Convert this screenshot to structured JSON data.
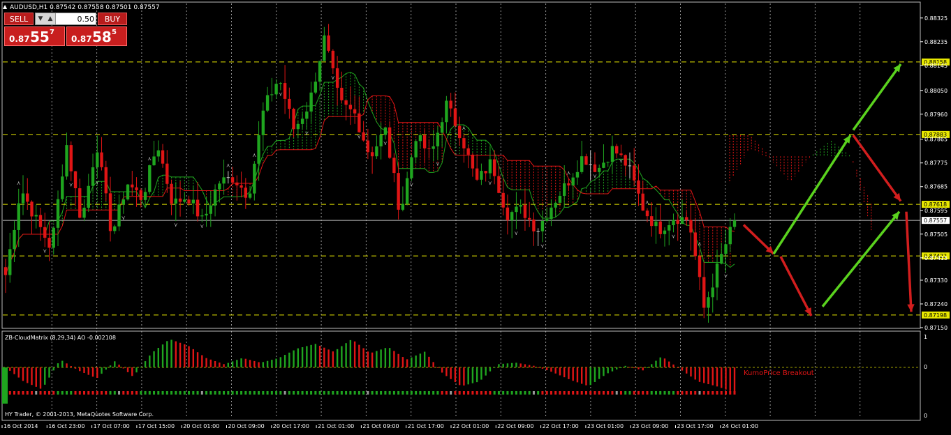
{
  "header": {
    "title": "AUDUSD,H1  0.87542 0.87558 0.87501 0.87557",
    "arrow_glyph": "▲"
  },
  "trade_panel": {
    "sell_label": "SELL",
    "buy_label": "BUY",
    "lot_value": "0.50",
    "sell_prefix": "0.87",
    "sell_big": "55",
    "sell_sup": "7",
    "buy_prefix": "0.87",
    "buy_big": "58",
    "buy_sup": "5"
  },
  "indicator": {
    "title": "ZB-CloudMatrix (8,29,34)  AO -0.002108",
    "annotation": "KumoPrice Breakout",
    "scale_labels": [
      "1",
      "0",
      "0"
    ]
  },
  "footer": {
    "copyright": "HY Trader, © 2001-2013, MetaQuotes Software Corp."
  },
  "colors": {
    "background": "#000000",
    "bull": "#1fa51f",
    "bear": "#e01515",
    "doji": "#c8c8c8",
    "level_line": "#e8e800",
    "arrow_up": "#5ad21e",
    "arrow_down": "#d21e1e",
    "grid": "#c8c8c8",
    "ao_neutral": "#9a9a9a"
  },
  "chart_data": {
    "type": "candlestick",
    "symbol": "AUDUSD",
    "timeframe": "H1",
    "ylim": [
      0.8715,
      0.8838
    ],
    "y_ticks": [
      "0.88325",
      "0.88235",
      "0.88145",
      "0.88050",
      "0.87960",
      "0.87865",
      "0.87775",
      "0.87685",
      "0.87595",
      "0.87505",
      "0.87415",
      "0.87330",
      "0.87240",
      "0.87150"
    ],
    "x_labels": [
      "16 Oct 2014",
      "16 Oct 23:00",
      "17 Oct 07:00",
      "17 Oct 15:00",
      "20 Oct 01:00",
      "20 Oct 09:00",
      "20 Oct 17:00",
      "21 Oct 01:00",
      "21 Oct 09:00",
      "21 Oct 17:00",
      "22 Oct 01:00",
      "22 Oct 09:00",
      "22 Oct 17:00",
      "23 Oct 01:00",
      "23 Oct 09:00",
      "23 Oct 17:00",
      "24 Oct 01:00"
    ],
    "levels": [
      {
        "label": "0.88158",
        "value": 0.88158
      },
      {
        "label": "0.87883",
        "value": 0.87883
      },
      {
        "label": "0.87618",
        "value": 0.87618
      },
      {
        "label": "0.87422",
        "value": 0.87422
      },
      {
        "label": "0.87198",
        "value": 0.87198
      }
    ],
    "current_price": {
      "label": "0.87557",
      "value": 0.87557
    },
    "key_prices": [
      0.8735,
      0.8768,
      0.8756,
      0.8745,
      0.8785,
      0.8755,
      0.8785,
      0.875,
      0.877,
      0.8764,
      0.8785,
      0.8762,
      0.8765,
      0.8755,
      0.877,
      0.8772,
      0.8765,
      0.8798,
      0.881,
      0.879,
      0.88,
      0.8825,
      0.88,
      0.8796,
      0.878,
      0.879,
      0.8758,
      0.8788,
      0.878,
      0.88,
      0.8788,
      0.877,
      0.8778,
      0.8758,
      0.876,
      0.8752,
      0.8762,
      0.877,
      0.878,
      0.8775,
      0.8783,
      0.8776,
      0.876,
      0.8752,
      0.8757,
      0.8756,
      0.8722,
      0.874,
      0.87557
    ],
    "forecast_arrows": [
      {
        "dir": "down",
        "x_time": "24 Oct 05:00",
        "from": 0.8754,
        "to": 0.8743
      },
      {
        "dir": "down",
        "x_time": "24 Oct 08:00",
        "from": 0.8742,
        "to": 0.87195
      },
      {
        "dir": "up",
        "x_time": "24 Oct 11:00",
        "from": 0.8723,
        "to": 0.8759
      },
      {
        "dir": "up",
        "x_time": "24 Oct 07:00",
        "from": 0.8743,
        "to": 0.8788
      },
      {
        "dir": "up",
        "x_time": "24 Oct 12:00",
        "from": 0.879,
        "to": 0.8815
      },
      {
        "dir": "down",
        "x_time": "24 Oct 12:00",
        "from": 0.8788,
        "to": 0.8763
      },
      {
        "dir": "down",
        "x_time": "24 Oct 16:00",
        "from": 0.8759,
        "to": 0.8721
      }
    ],
    "ao_key": [
      0.0,
      -0.45,
      -0.7,
      0.25,
      -0.1,
      -0.35,
      0.2,
      -0.3,
      0.45,
      0.9,
      0.7,
      0.3,
      0.1,
      0.3,
      0.15,
      0.3,
      0.6,
      0.75,
      0.5,
      0.9,
      0.45,
      0.65,
      0.25,
      0.5,
      -0.2,
      -0.6,
      -0.45,
      0.1,
      0.15,
      0.05,
      -0.15,
      -0.4,
      -0.6,
      -0.2,
      0.05,
      -0.1,
      0.35,
      -0.05,
      -0.45,
      -0.6,
      -0.8
    ]
  }
}
